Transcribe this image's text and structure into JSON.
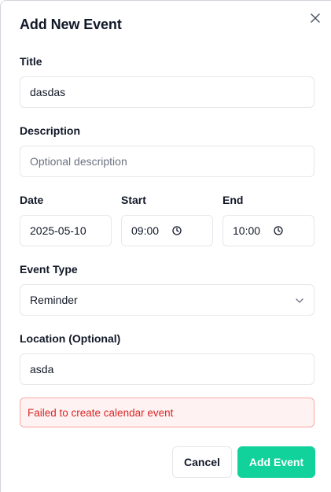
{
  "dialog": {
    "title": "Add New Event"
  },
  "form": {
    "title_label": "Title",
    "title_value": "dasdas",
    "description_label": "Description",
    "description_placeholder": "Optional description",
    "date_label": "Date",
    "date_value": "2025-05-10",
    "start_label": "Start",
    "start_value": "09:00",
    "end_label": "End",
    "end_value": "10:00",
    "event_type_label": "Event Type",
    "event_type_value": "Reminder",
    "location_label": "Location (Optional)",
    "location_value": "asda"
  },
  "error": {
    "message": "Failed to create calendar event"
  },
  "actions": {
    "cancel_label": "Cancel",
    "submit_label": "Add Event"
  },
  "colors": {
    "primary_button": "#10d29a",
    "error_text": "#dc2626",
    "error_bg": "#fef2f2",
    "error_border": "#fca5a5"
  },
  "icons": {
    "close": "close-icon",
    "clock": "clock-icon",
    "chevron": "chevron-down-icon"
  }
}
